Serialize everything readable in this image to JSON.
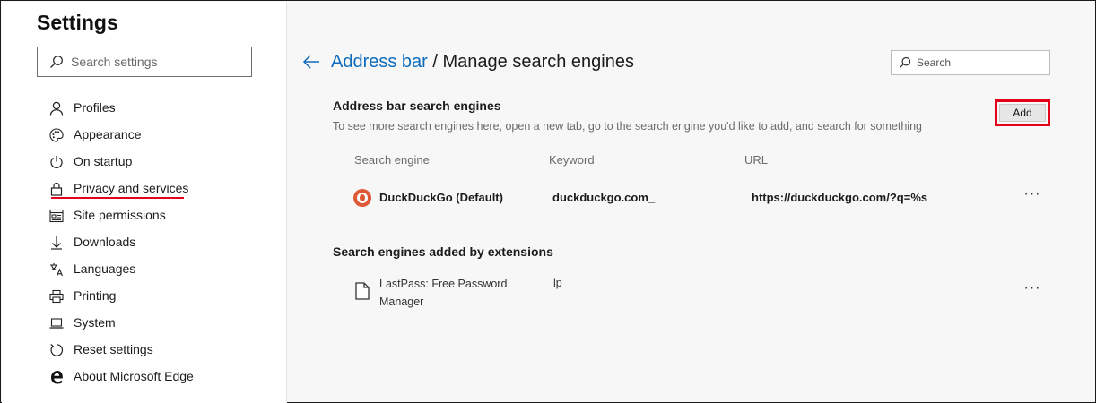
{
  "sidebar": {
    "title": "Settings",
    "search_placeholder": "Search settings",
    "items": [
      {
        "label": "Profiles",
        "icon": "person-icon"
      },
      {
        "label": "Appearance",
        "icon": "palette-icon"
      },
      {
        "label": "On startup",
        "icon": "power-icon"
      },
      {
        "label": "Privacy and services",
        "icon": "lock-icon",
        "active": true
      },
      {
        "label": "Site permissions",
        "icon": "site-permissions-icon"
      },
      {
        "label": "Downloads",
        "icon": "download-icon"
      },
      {
        "label": "Languages",
        "icon": "languages-icon"
      },
      {
        "label": "Printing",
        "icon": "printer-icon"
      },
      {
        "label": "System",
        "icon": "laptop-icon"
      },
      {
        "label": "Reset settings",
        "icon": "reset-icon"
      },
      {
        "label": "About Microsoft Edge",
        "icon": "edge-logo-icon"
      }
    ]
  },
  "header": {
    "breadcrumb_link": "Address bar",
    "breadcrumb_sep": " / ",
    "breadcrumb_current": "Manage search engines",
    "search_placeholder": "Search"
  },
  "address_bar_engines": {
    "title": "Address bar search engines",
    "description": "To see more search engines here, open a new tab, go to the search engine you'd like to add, and search for something",
    "add_label": "Add",
    "columns": [
      "Search engine",
      "Keyword",
      "URL"
    ],
    "rows": [
      {
        "name": "DuckDuckGo (Default)",
        "keyword": "duckduckgo.com_",
        "url": "https://duckduckgo.com/?q=%s",
        "more": "···"
      }
    ]
  },
  "extension_engines": {
    "title": "Search engines added by extensions",
    "rows": [
      {
        "name": "LastPass: Free Password Manager",
        "keyword": "lp",
        "more": "···"
      }
    ]
  },
  "colors": {
    "accent": "#0f6cbd",
    "highlight": "#e4001b",
    "duckduckgo": "#de5833"
  }
}
